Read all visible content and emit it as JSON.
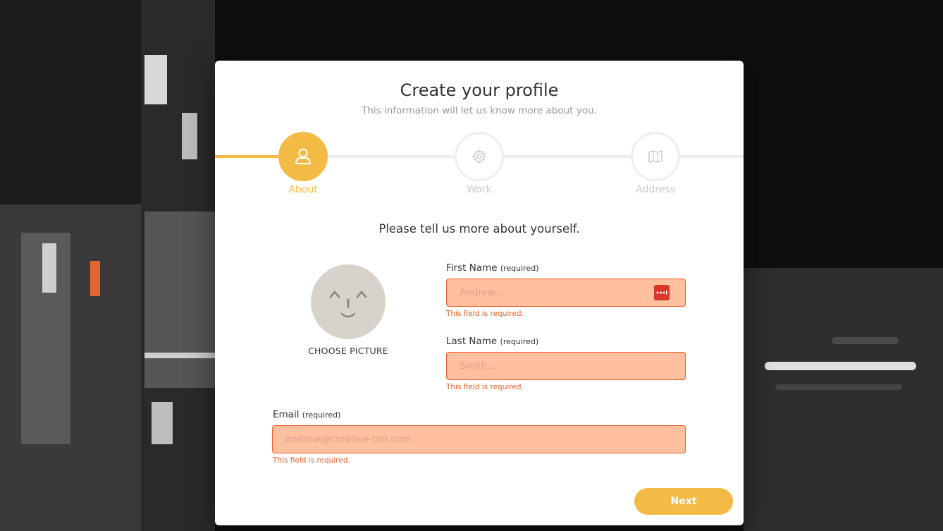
{
  "header": {
    "title": "Create your profile",
    "subtitle": "This information will let us know more about you."
  },
  "steps": [
    {
      "label": "About",
      "icon": "user-icon",
      "active": true
    },
    {
      "label": "Work",
      "icon": "gear-icon",
      "active": false
    },
    {
      "label": "Address",
      "icon": "map-icon",
      "active": false
    }
  ],
  "form": {
    "lead": "Please tell us more about yourself.",
    "picture_label": "CHOOSE PICTURE",
    "first_name": {
      "label": "First Name",
      "hint": "(required)",
      "placeholder": "Andrew...",
      "value": "",
      "error": "This field is required."
    },
    "last_name": {
      "label": "Last Name",
      "hint": "(required)",
      "placeholder": "Smith...",
      "value": "",
      "error": "This field is required."
    },
    "email": {
      "label": "Email",
      "hint": "(required)",
      "placeholder": "andrew@creative-tim.com",
      "value": "",
      "error": "This field is required."
    }
  },
  "actions": {
    "next_label": "Next"
  },
  "colors": {
    "accent": "#f3bb45",
    "error": "#eb5e28",
    "error_fill": "#ffc0a0"
  }
}
